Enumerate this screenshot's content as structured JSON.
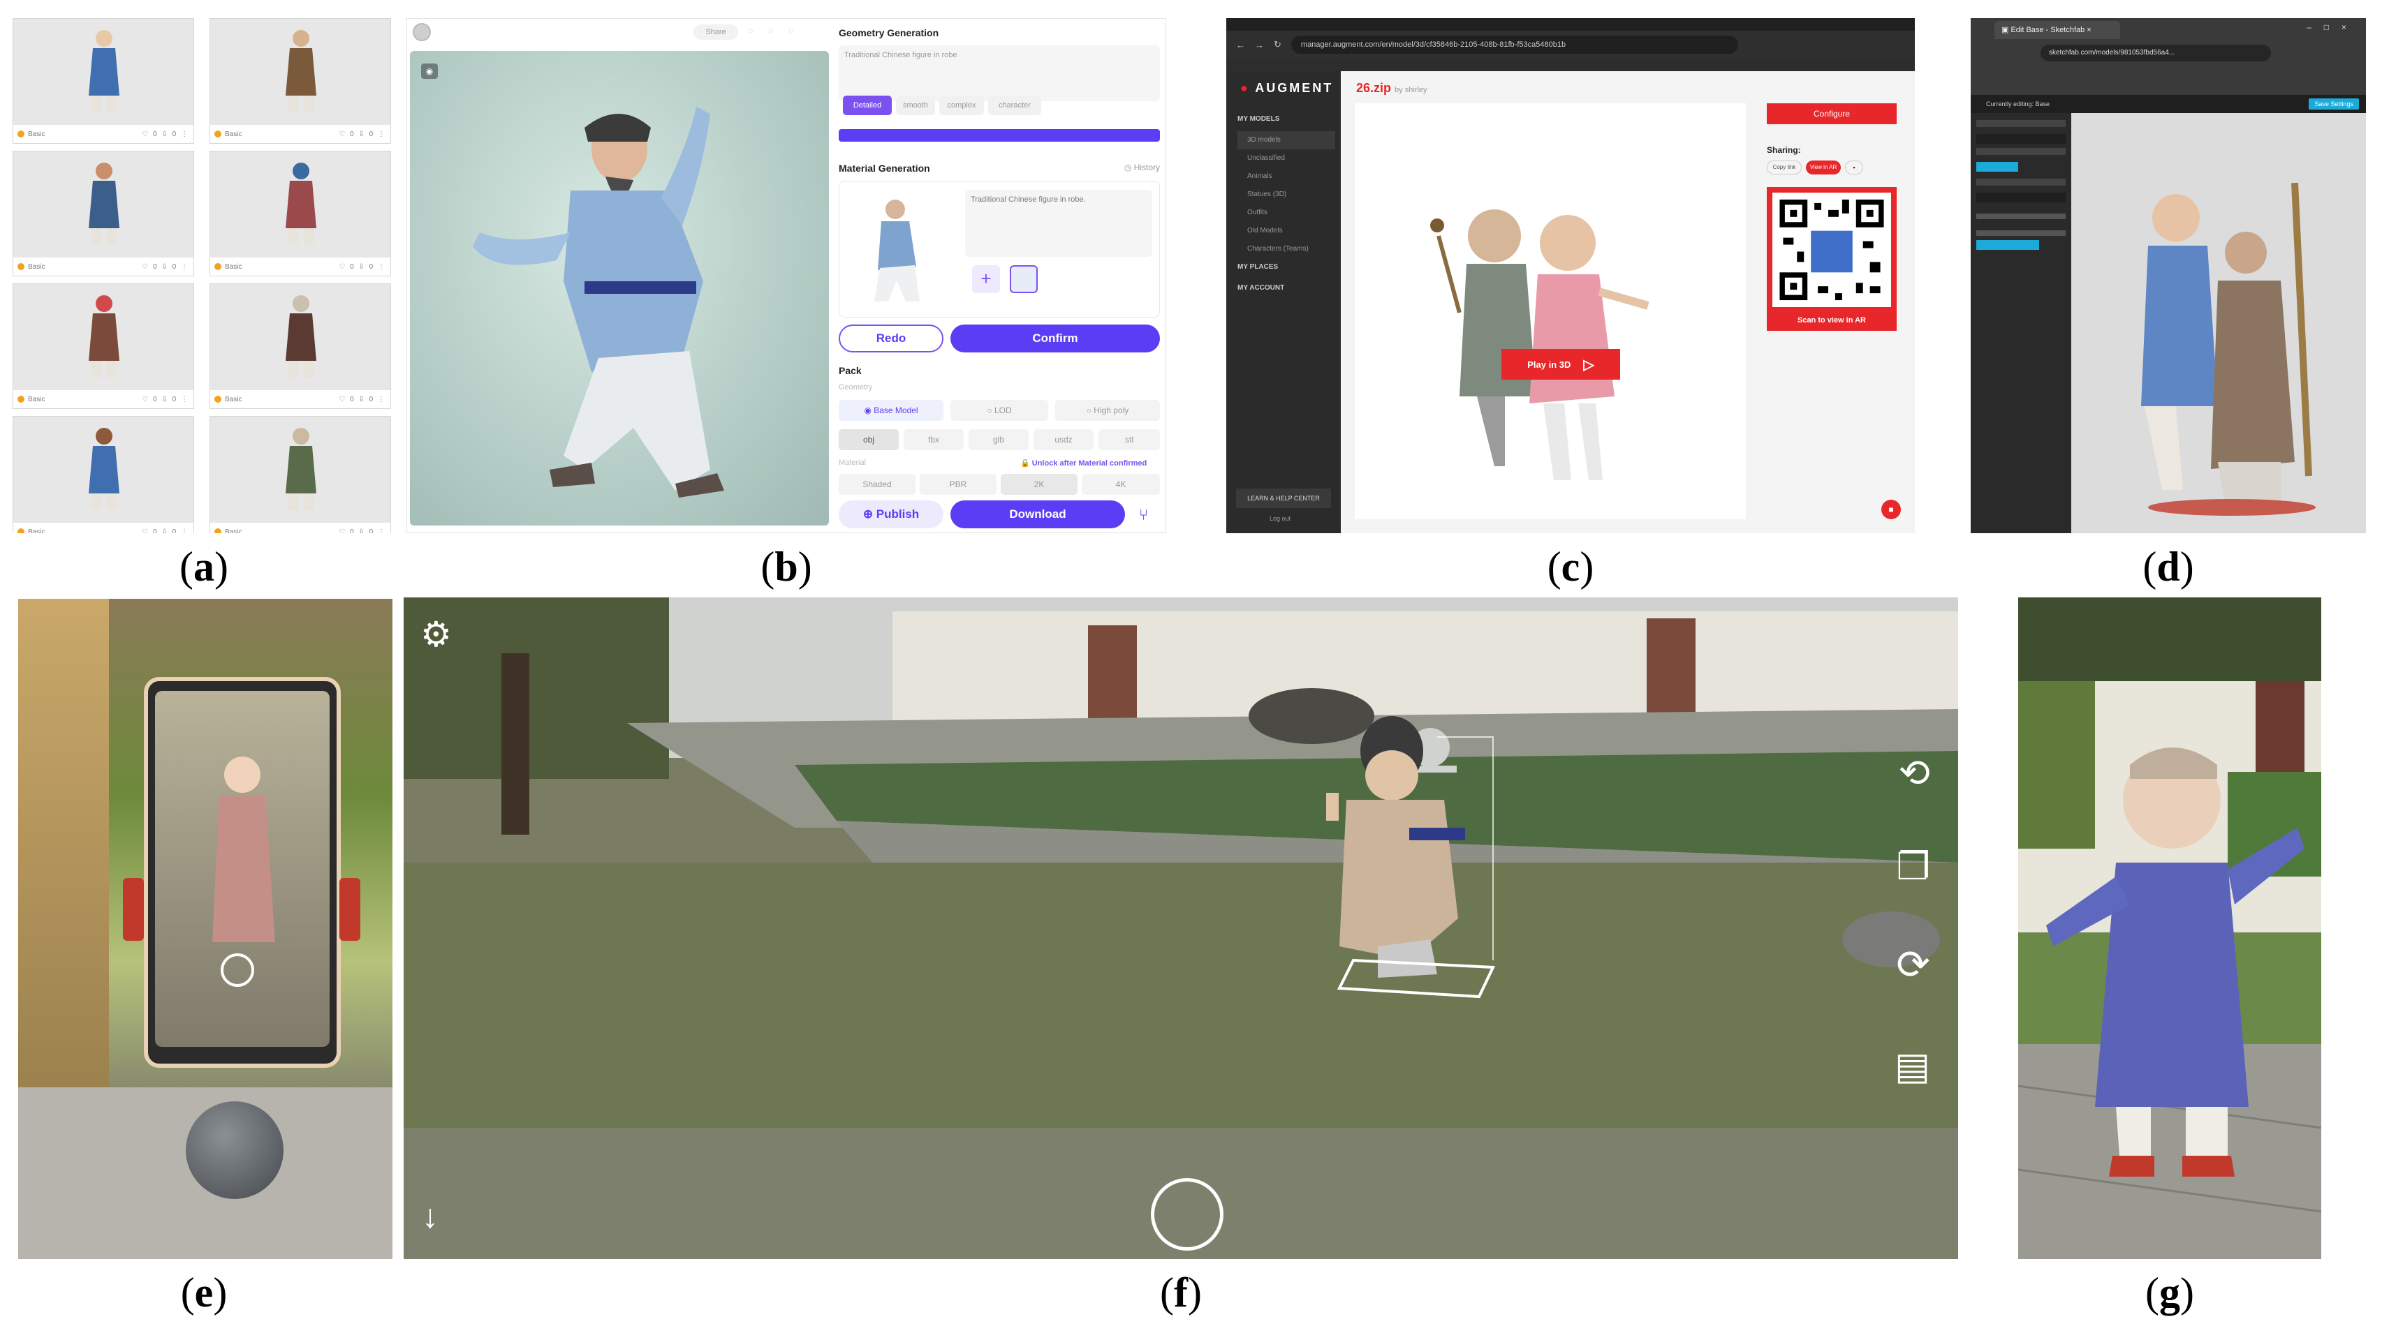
{
  "captions": {
    "a": "a",
    "b": "b",
    "c": "c",
    "d": "d",
    "e": "e",
    "f": "f",
    "g": "g"
  },
  "panel_a": {
    "tiles": [
      {
        "label": "Basic",
        "meta": "♡ 0  ⇩ 0  ⋮"
      },
      {
        "label": "Basic",
        "meta": "♡ 0  ⇩ 0  ⋮"
      },
      {
        "label": "Basic",
        "meta": "♡ 0  ⇩ 0  ⋮"
      },
      {
        "label": "Basic",
        "meta": "♡ 0  ⇩ 0  ⋮"
      },
      {
        "label": "Basic",
        "meta": "♡ 0  ⇩ 0  ⋮"
      },
      {
        "label": "Basic",
        "meta": "♡ 0  ⇩ 0  ⋮"
      },
      {
        "label": "Basic",
        "meta": "♡ 0  ⇩ 0  ⋮"
      },
      {
        "label": "Basic",
        "meta": "♡ 0  ⇩ 0  ⋮"
      }
    ]
  },
  "panel_b": {
    "share_label": "Share",
    "geometry_title": "Geometry Generation",
    "prompt_text": "Traditional Chinese figure in robe",
    "styles": [
      "Detailed",
      "smooth",
      "complex",
      "character"
    ],
    "material_title": "Material Generation",
    "history_label": "History",
    "material_prompt": "Traditional Chinese figure in robe.",
    "redo_label": "Redo",
    "confirm_label": "Confirm",
    "pack_title": "Pack",
    "geometry_label": "Geometry",
    "geometry_options": [
      "Base Model",
      "LOD",
      "High poly"
    ],
    "formats": [
      "obj",
      "fbx",
      "glb",
      "usdz",
      "stl"
    ],
    "material_label": "Material",
    "unlock_text": "Unlock after Material confirmed",
    "material_options": [
      "Shaded",
      "PBR",
      "2K",
      "4K"
    ],
    "publish_label": "Publish",
    "download_label": "Download",
    "colors": {
      "accent": "#5b3df5",
      "redo": "#7b52f0"
    }
  },
  "panel_c": {
    "url": "manager.augment.com/en/model/3d/cf35846b-2105-408b-81fb-f53ca5480b1b",
    "brand": "AUGMENT",
    "sidebar_items": [
      "MY MODELS",
      "3D models",
      "Unclassified",
      "Animals",
      "Statues (3D)",
      "Outfits",
      "Old Models",
      "Characters (Teams)",
      "MY PLACES",
      "MY ACCOUNT"
    ],
    "help_label": "LEARN & HELP CENTER",
    "logout_label": "Log out",
    "file_title": "26.zip",
    "file_by": "by shirley",
    "play_label": "Play in 3D",
    "configure_label": "Configure",
    "sharing_label": "Sharing:",
    "share_buttons": [
      "Copy link",
      "View in AR"
    ],
    "scan_label": "Scan to view in AR",
    "colors": {
      "red": "#e8272a"
    }
  },
  "panel_d": {
    "tab_title": "Edit Base - Sketchfab",
    "url": "sketchfab.com/models/981053fbd56a4...",
    "editor_title": "Currently editing: Base",
    "save_label": "Save Settings"
  },
  "panel_f": {
    "icons": [
      "gear-icon",
      "rotate-360-icon",
      "layers-icon",
      "refresh-icon",
      "list-icon",
      "download-icon",
      "shutter-icon"
    ]
  }
}
